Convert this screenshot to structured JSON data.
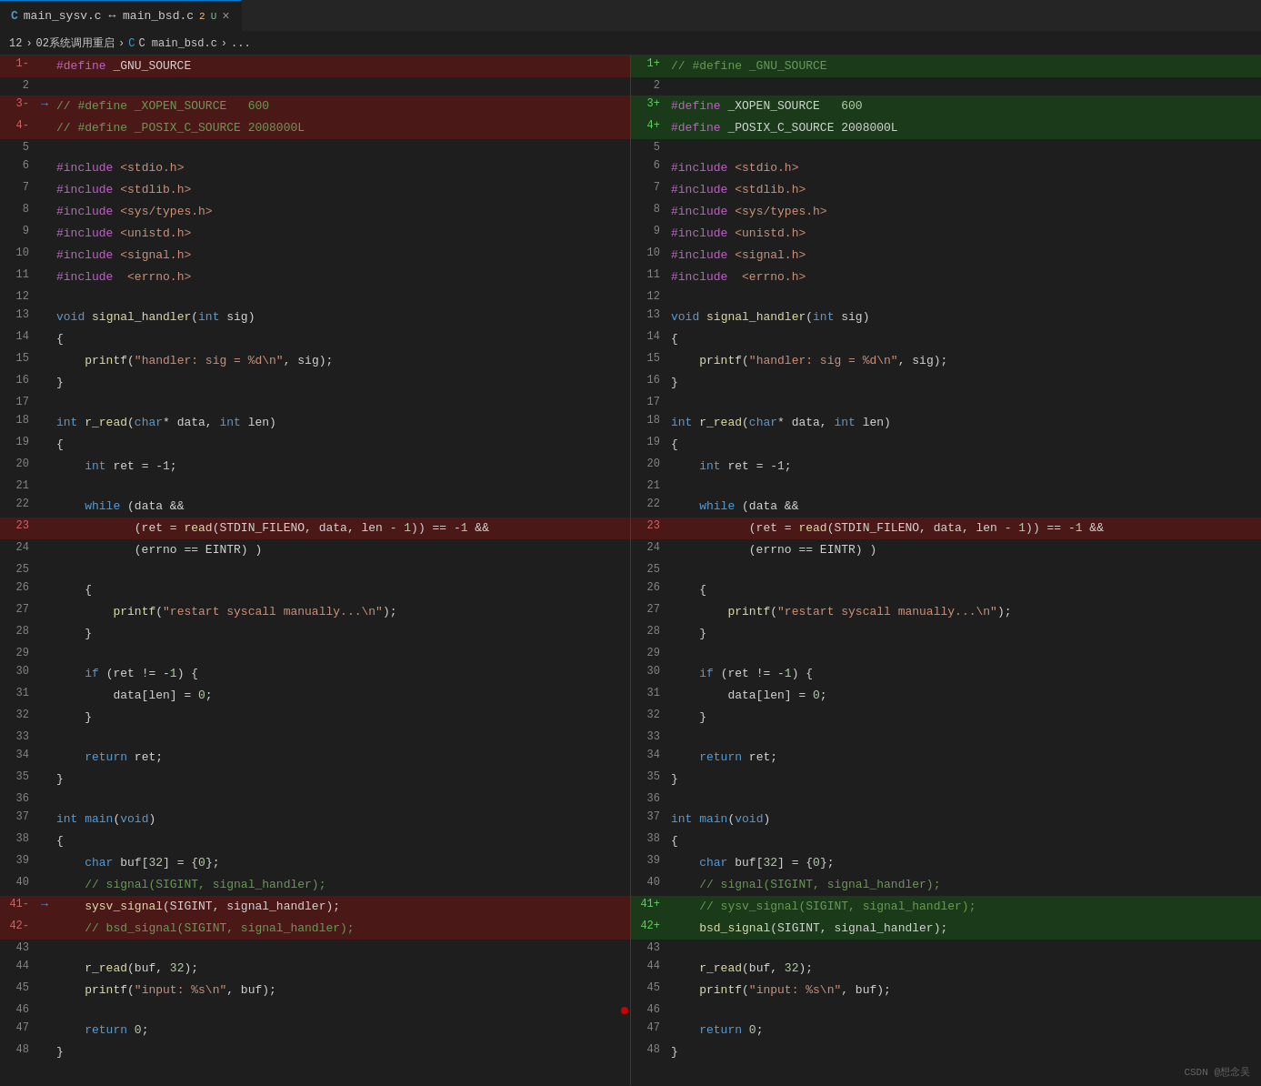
{
  "tab": {
    "label": "main_sysv.c ↔ main_bsd.c",
    "modified_count": "2",
    "modified_label": "U",
    "close_symbol": "×"
  },
  "breadcrumb": {
    "item1": "12",
    "item2": "02系统调用重启",
    "item3": "C  main_bsd.c",
    "item4": "..."
  },
  "left_pane": {
    "lines": [
      {
        "num": "1-",
        "arrow": "",
        "content": "#define _GNU_SOURCE",
        "type": "deleted"
      },
      {
        "num": "2",
        "arrow": "",
        "content": "",
        "type": "normal"
      },
      {
        "num": "3-",
        "arrow": "→",
        "content": "// #define _XOPEN_SOURCE   600",
        "type": "deleted"
      },
      {
        "num": "4-",
        "arrow": "",
        "content": "// #define _POSIX_C_SOURCE 2008000L",
        "type": "deleted"
      },
      {
        "num": "5",
        "arrow": "",
        "content": "",
        "type": "normal"
      },
      {
        "num": "6",
        "arrow": "",
        "content": "#include <stdio.h>",
        "type": "normal"
      },
      {
        "num": "7",
        "arrow": "",
        "content": "#include <stdlib.h>",
        "type": "normal"
      },
      {
        "num": "8",
        "arrow": "",
        "content": "#include <sys/types.h>",
        "type": "normal"
      },
      {
        "num": "9",
        "arrow": "",
        "content": "#include <unistd.h>",
        "type": "normal",
        "underline": true
      },
      {
        "num": "10",
        "arrow": "",
        "content": "#include <signal.h>",
        "type": "normal"
      },
      {
        "num": "11",
        "arrow": "",
        "content": "#include  <errno.h>",
        "type": "normal"
      },
      {
        "num": "12",
        "arrow": "",
        "content": "",
        "type": "normal"
      },
      {
        "num": "13",
        "arrow": "",
        "content": "void signal_handler(int sig)",
        "type": "normal"
      },
      {
        "num": "14",
        "arrow": "",
        "content": "{",
        "type": "normal"
      },
      {
        "num": "15",
        "arrow": "",
        "content": "    printf(\"handler: sig = %d\\n\", sig);",
        "type": "normal"
      },
      {
        "num": "16",
        "arrow": "",
        "content": "}",
        "type": "normal"
      },
      {
        "num": "17",
        "arrow": "",
        "content": "",
        "type": "normal"
      },
      {
        "num": "18",
        "arrow": "",
        "content": "int r_read(char* data, int len)",
        "type": "normal"
      },
      {
        "num": "19",
        "arrow": "",
        "content": "{",
        "type": "normal"
      },
      {
        "num": "20",
        "arrow": "",
        "content": "    int ret = -1;",
        "type": "normal"
      },
      {
        "num": "21",
        "arrow": "",
        "content": "",
        "type": "normal"
      },
      {
        "num": "22",
        "arrow": "",
        "content": "    while (data &&",
        "type": "normal"
      },
      {
        "num": "23",
        "arrow": "",
        "content": "           (ret = read(STDIN_FILENO, data, len - 1)) == -1 &&",
        "type": "deleted"
      },
      {
        "num": "24",
        "arrow": "",
        "content": "           (errno == EINTR) )",
        "type": "normal"
      },
      {
        "num": "25",
        "arrow": "",
        "content": "",
        "type": "normal"
      },
      {
        "num": "26",
        "arrow": "",
        "content": "    {",
        "type": "normal"
      },
      {
        "num": "27",
        "arrow": "",
        "content": "        printf(\"restart syscall manually...\\n\");",
        "type": "normal"
      },
      {
        "num": "28",
        "arrow": "",
        "content": "    }",
        "type": "normal"
      },
      {
        "num": "29",
        "arrow": "",
        "content": "",
        "type": "normal"
      },
      {
        "num": "30",
        "arrow": "",
        "content": "    if (ret != -1) {",
        "type": "normal"
      },
      {
        "num": "31",
        "arrow": "",
        "content": "        data[len] = 0;",
        "type": "normal"
      },
      {
        "num": "32",
        "arrow": "",
        "content": "    }",
        "type": "normal"
      },
      {
        "num": "33",
        "arrow": "",
        "content": "",
        "type": "normal"
      },
      {
        "num": "34",
        "arrow": "",
        "content": "    return ret;",
        "type": "normal"
      },
      {
        "num": "35",
        "arrow": "",
        "content": "}",
        "type": "normal"
      },
      {
        "num": "36",
        "arrow": "",
        "content": "",
        "type": "normal"
      },
      {
        "num": "37",
        "arrow": "",
        "content": "int main(void)",
        "type": "normal"
      },
      {
        "num": "38",
        "arrow": "",
        "content": "{",
        "type": "normal"
      },
      {
        "num": "39",
        "arrow": "",
        "content": "    char buf[32] = {0};",
        "type": "normal"
      },
      {
        "num": "40",
        "arrow": "",
        "content": "    // signal(SIGINT, signal_handler);",
        "type": "normal"
      },
      {
        "num": "41-",
        "arrow": "→",
        "content": "    sysv_signal(SIGINT, signal_handler);",
        "type": "deleted"
      },
      {
        "num": "42-",
        "arrow": "",
        "content": "    // bsd_signal(SIGINT, signal_handler);",
        "type": "deleted"
      },
      {
        "num": "43",
        "arrow": "",
        "content": "",
        "type": "normal"
      },
      {
        "num": "44",
        "arrow": "",
        "content": "    r_read(buf, 32);",
        "type": "normal"
      },
      {
        "num": "45",
        "arrow": "",
        "content": "    printf(\"input: %s\\n\", buf);",
        "type": "normal"
      },
      {
        "num": "46",
        "arrow": "",
        "content": "",
        "type": "normal",
        "dot": true
      },
      {
        "num": "47",
        "arrow": "",
        "content": "    return 0;",
        "type": "normal"
      },
      {
        "num": "48",
        "arrow": "",
        "content": "}",
        "type": "normal"
      }
    ]
  },
  "right_pane": {
    "lines": [
      {
        "num": "1+",
        "content": "// #define _GNU_SOURCE",
        "type": "added"
      },
      {
        "num": "2",
        "content": "",
        "type": "normal"
      },
      {
        "num": "3+",
        "content": "#define _XOPEN_SOURCE   600",
        "type": "added"
      },
      {
        "num": "4+",
        "content": "#define _POSIX_C_SOURCE 2008000L",
        "type": "added"
      },
      {
        "num": "5",
        "content": "",
        "type": "normal"
      },
      {
        "num": "6",
        "content": "#include <stdio.h>",
        "type": "normal"
      },
      {
        "num": "7",
        "content": "#include <stdlib.h>",
        "type": "normal"
      },
      {
        "num": "8",
        "content": "#include <sys/types.h>",
        "type": "normal"
      },
      {
        "num": "9",
        "content": "#include <unistd.h>",
        "type": "normal",
        "underline": true
      },
      {
        "num": "10",
        "content": "#include <signal.h>",
        "type": "normal"
      },
      {
        "num": "11",
        "content": "#include  <errno.h>",
        "type": "normal"
      },
      {
        "num": "12",
        "content": "",
        "type": "normal"
      },
      {
        "num": "13",
        "content": "void signal_handler(int sig)",
        "type": "normal"
      },
      {
        "num": "14",
        "content": "{",
        "type": "normal"
      },
      {
        "num": "15",
        "content": "    printf(\"handler: sig = %d\\n\", sig);",
        "type": "normal"
      },
      {
        "num": "16",
        "content": "}",
        "type": "normal"
      },
      {
        "num": "17",
        "content": "",
        "type": "normal"
      },
      {
        "num": "18",
        "content": "int r_read(char* data, int len)",
        "type": "normal"
      },
      {
        "num": "19",
        "content": "{",
        "type": "normal"
      },
      {
        "num": "20",
        "content": "    int ret = -1;",
        "type": "normal"
      },
      {
        "num": "21",
        "content": "",
        "type": "normal"
      },
      {
        "num": "22",
        "content": "    while (data &&",
        "type": "normal"
      },
      {
        "num": "23",
        "content": "           (ret = read(STDIN_FILENO, data, len - 1)) == -1 &&",
        "type": "deleted"
      },
      {
        "num": "24",
        "content": "           (errno == EINTR) )",
        "type": "normal"
      },
      {
        "num": "25",
        "content": "",
        "type": "normal"
      },
      {
        "num": "26",
        "content": "    {",
        "type": "normal"
      },
      {
        "num": "27",
        "content": "        printf(\"restart syscall manually...\\n\");",
        "type": "normal"
      },
      {
        "num": "28",
        "content": "    }",
        "type": "normal"
      },
      {
        "num": "29",
        "content": "",
        "type": "normal"
      },
      {
        "num": "30",
        "content": "    if (ret != -1) {",
        "type": "normal"
      },
      {
        "num": "31",
        "content": "        data[len] = 0;",
        "type": "normal"
      },
      {
        "num": "32",
        "content": "    }",
        "type": "normal"
      },
      {
        "num": "33",
        "content": "",
        "type": "normal"
      },
      {
        "num": "34",
        "content": "    return ret;",
        "type": "normal"
      },
      {
        "num": "35",
        "content": "}",
        "type": "normal"
      },
      {
        "num": "36",
        "content": "",
        "type": "normal"
      },
      {
        "num": "37",
        "content": "int main(void)",
        "type": "normal"
      },
      {
        "num": "38",
        "content": "{",
        "type": "normal"
      },
      {
        "num": "39",
        "content": "    char buf[32] = {0};",
        "type": "normal"
      },
      {
        "num": "40",
        "content": "    // signal(SIGINT, signal_handler);",
        "type": "normal"
      },
      {
        "num": "41+",
        "content": "    // sysv_signal(SIGINT, signal_handler);",
        "type": "added"
      },
      {
        "num": "42+",
        "content": "    bsd_signal(SIGINT, signal_handler);",
        "type": "added"
      },
      {
        "num": "43",
        "content": "",
        "type": "normal"
      },
      {
        "num": "44",
        "content": "    r_read(buf, 32);",
        "type": "normal"
      },
      {
        "num": "45",
        "content": "    printf(\"input: %s\\n\", buf);",
        "type": "normal"
      },
      {
        "num": "46",
        "content": "",
        "type": "normal"
      },
      {
        "num": "47",
        "content": "    return 0;",
        "type": "normal"
      },
      {
        "num": "48",
        "content": "}",
        "type": "normal"
      }
    ]
  },
  "watermark": "CSDN @想念吴"
}
